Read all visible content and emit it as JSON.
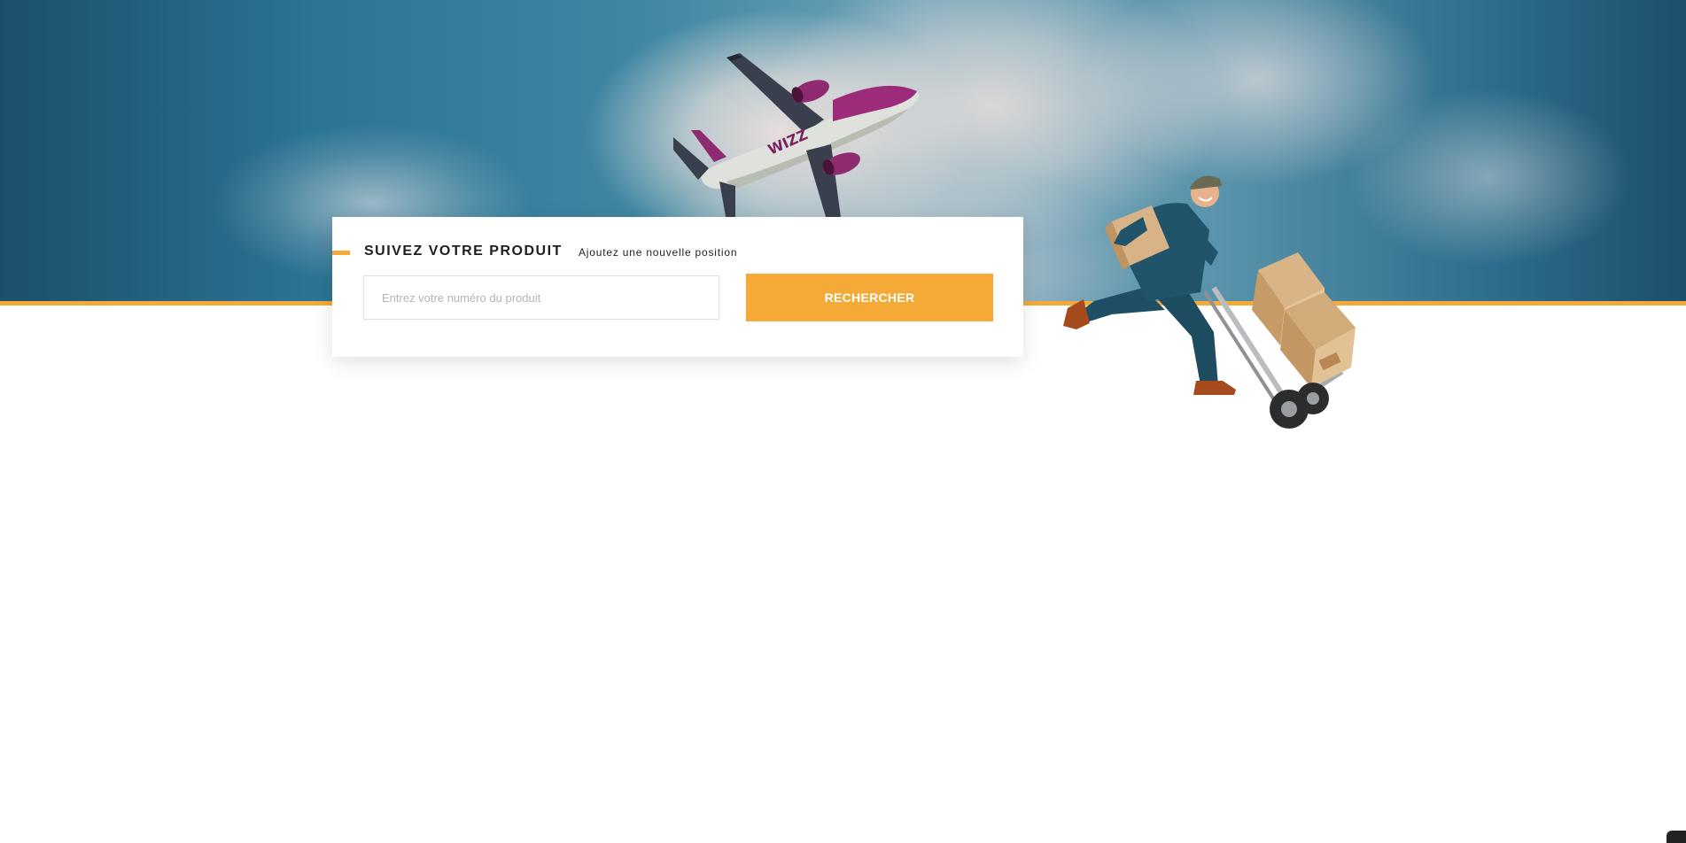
{
  "tracking": {
    "title": "SUIVEZ VOTRE PRODUIT",
    "subtitle": "Ajoutez une nouvelle position",
    "input_placeholder": "Entrez votre numéro du produit",
    "input_value": "",
    "search_label": "RECHERCHER"
  },
  "hero": {
    "plane_livery_text": "WIZZ",
    "plane_image": "airplane-taking-off",
    "courier_image": "delivery-man-with-hand-truck"
  },
  "colors": {
    "accent": "#f5a936",
    "sky_dark": "#1c4f6a",
    "sky_light": "#6ea2b7",
    "text_dark": "#1e1e1e",
    "placeholder": "#b4b4b4"
  },
  "icons": {
    "corner": "chat-widget-icon"
  }
}
